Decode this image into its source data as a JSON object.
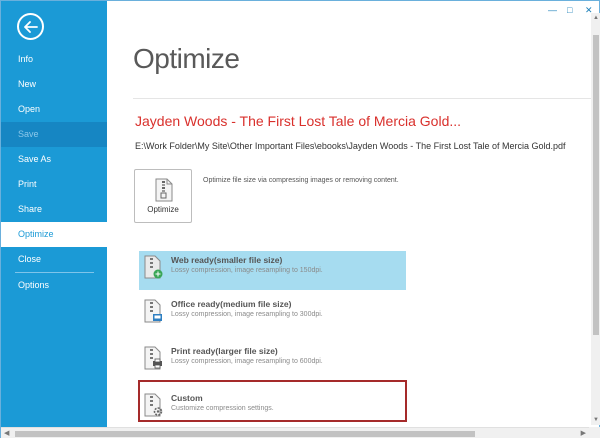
{
  "window": {
    "minimize_glyph": "—",
    "restore_glyph": "□",
    "close_glyph": "✕"
  },
  "sidebar": {
    "back_icon": "back-arrow-icon",
    "items": [
      {
        "label": "Info",
        "state": "normal"
      },
      {
        "label": "New",
        "state": "normal"
      },
      {
        "label": "Open",
        "state": "normal"
      },
      {
        "label": "Save",
        "state": "disabled"
      },
      {
        "label": "Save As",
        "state": "normal"
      },
      {
        "label": "Print",
        "state": "normal"
      },
      {
        "label": "Share",
        "state": "normal"
      },
      {
        "label": "Optimize",
        "state": "active"
      },
      {
        "label": "Close",
        "state": "normal"
      },
      {
        "label": "Options",
        "state": "normal"
      }
    ]
  },
  "main": {
    "title": "Optimize",
    "doc_title": "Jayden Woods - The First Lost Tale of Mercia Gold...",
    "doc_path": "E:\\Work Folder\\My Site\\Other Important Files\\ebooks\\Jayden Woods - The First Lost Tale of Mercia Gold.pdf",
    "optimize_button": {
      "label": "Optimize",
      "icon": "zip-file-icon"
    },
    "optimize_description": "Optimize file size via compressing images or removing content.",
    "options": [
      {
        "title": "Web ready(smaller file size)",
        "description": "Lossy compression, image resampling to 150dpi.",
        "icon": "web-file-icon",
        "selected": true
      },
      {
        "title": "Office ready(medium file size)",
        "description": "Lossy compression, image resampling to 300dpi.",
        "icon": "office-file-icon",
        "selected": false
      },
      {
        "title": "Print ready(larger file size)",
        "description": "Lossy compression, image resampling to 600dpi.",
        "icon": "print-file-icon",
        "selected": false
      },
      {
        "title": "Custom",
        "description": "Customize compression settings.",
        "icon": "custom-settings-file-icon",
        "selected": false
      }
    ]
  },
  "colors": {
    "sidebar": "#1b9ad6",
    "doc_title": "#d9302c",
    "selected_option": "#a6dcf0",
    "highlight_box": "#a52a2a"
  }
}
